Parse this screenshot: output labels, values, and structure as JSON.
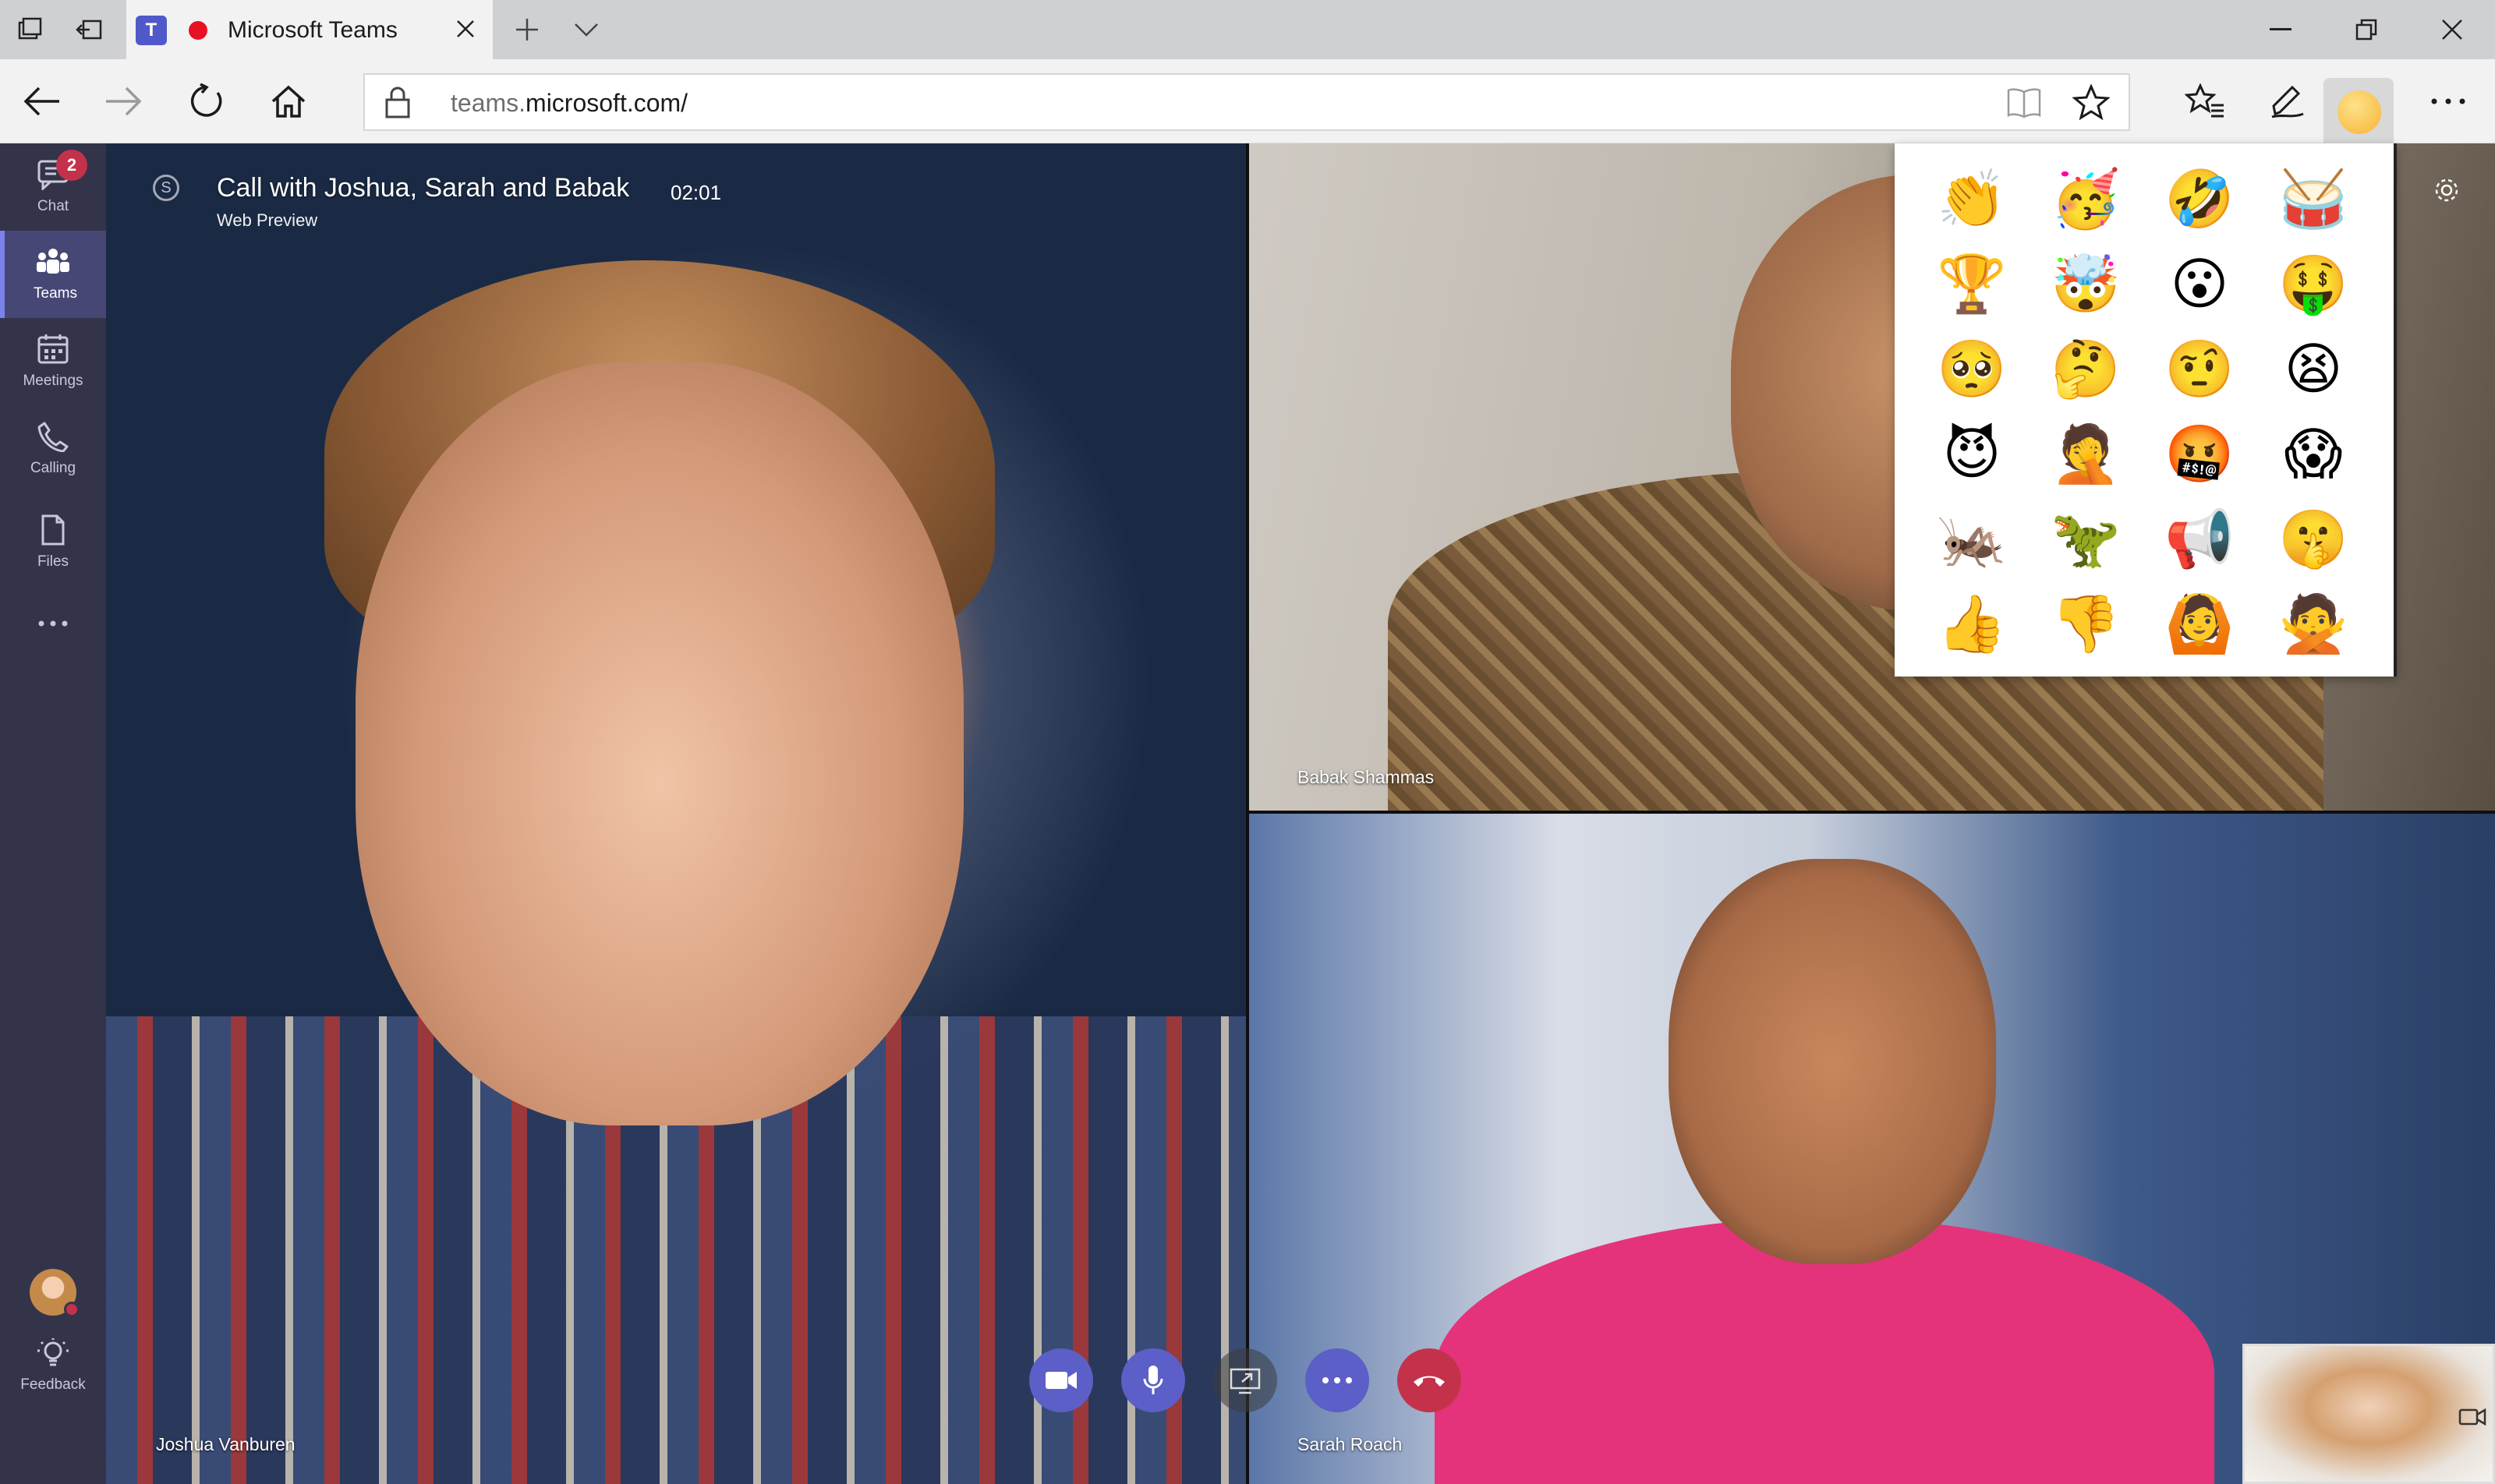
{
  "browser": {
    "tab_title": "Microsoft Teams",
    "tab_app_letter": "T",
    "url_prefix": "teams.",
    "url_domain": "microsoft.com/",
    "accent": "#5059c9",
    "recording_color": "#e81123"
  },
  "teams_rail": {
    "items": [
      {
        "label": "Chat",
        "icon": "chat-icon",
        "badge": "2"
      },
      {
        "label": "Teams",
        "icon": "teams-icon",
        "active": true
      },
      {
        "label": "Meetings",
        "icon": "calendar-icon"
      },
      {
        "label": "Calling",
        "icon": "phone-icon"
      },
      {
        "label": "Files",
        "icon": "file-icon"
      },
      {
        "label": "",
        "icon": "more-icon"
      }
    ],
    "feedback_label": "Feedback",
    "rail_color": "#33344a",
    "active_color": "#464775"
  },
  "call": {
    "title": "Call with Joshua, Sarah and Babak",
    "timer": "02:01",
    "subtitle": "Web Preview",
    "participants": {
      "joshua": "Joshua Vanburen",
      "babak": "Babak Shammas",
      "sarah": "Sarah Roach"
    },
    "controls": [
      "video-icon",
      "microphone-icon",
      "share-screen-icon",
      "more-icon",
      "hang-up-icon"
    ],
    "control_color": "#5b5fc7",
    "hangup_color": "#c4314b"
  },
  "emoji_panel": {
    "emojis": [
      "👏",
      "🥳",
      "🤣",
      "🥁",
      "🏆",
      "🤯",
      "😮",
      "🤑",
      "🥺",
      "🤔",
      "🤨",
      "😫",
      "😈",
      "🤦",
      "🤬",
      "😱",
      "🦗",
      "🦖",
      "📢",
      "🤫",
      "👍",
      "👎",
      "🙆",
      "🙅"
    ]
  }
}
